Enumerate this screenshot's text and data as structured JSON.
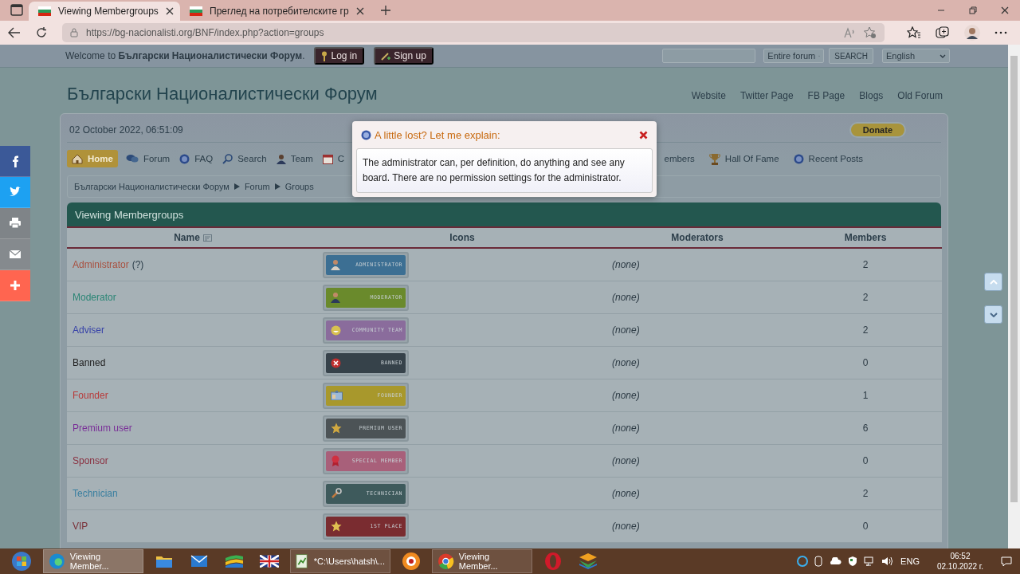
{
  "browser": {
    "tabs": [
      {
        "title": "Viewing Membergroups",
        "selected": true
      },
      {
        "title": "Преглед на потребителските гр",
        "selected": false
      }
    ],
    "url": "https://bg-nacionalisti.org/BNF/index.php?action=groups"
  },
  "userbar": {
    "welcome": "Welcome to **Български Националистически Форум**.",
    "buttons": [
      "Log in",
      "Sign up"
    ],
    "search_scope": "Entire forum",
    "search_button": "SEARCH",
    "language": "English"
  },
  "forum_title": "Български Националистически Форум",
  "top_links": [
    "Website",
    "Twitter Page",
    "FB Page",
    "Blogs",
    "Old Forum"
  ],
  "date": "02 October 2022, 06:51:09",
  "donate": "Donate",
  "nav": [
    {
      "label": "Home",
      "selected": true
    },
    {
      "label": "Forum",
      "selected": false
    },
    {
      "label": "FAQ",
      "selected": false
    },
    {
      "label": "Search",
      "selected": false
    },
    {
      "label": "Team",
      "selected": false
    },
    {
      "label": "C",
      "selected": false
    }
  ],
  "nav_right": [
    {
      "label": "embers",
      "selected": false
    },
    {
      "label": "Hall Of Fame",
      "selected": false
    },
    {
      "label": "Recent Posts",
      "selected": false
    }
  ],
  "breadcrumb": [
    "Български Националистически Форум",
    "Forum",
    "Groups"
  ],
  "table": {
    "title": "Viewing Membergroups",
    "columns": [
      "Name",
      "Icons",
      "Moderators",
      "Members"
    ],
    "rows": [
      {
        "name": "Administrator",
        "help": "(?)",
        "color": "#a8503f",
        "badge": {
          "label": "ADMINISTRATOR",
          "color": "#3c6f93"
        },
        "moderators": "(none)",
        "members": "2"
      },
      {
        "name": "Moderator",
        "color": "#2a8575",
        "badge": {
          "label": "MODERATOR",
          "color": "#6a8a2c"
        },
        "moderators": "(none)",
        "members": "2"
      },
      {
        "name": "Adviser",
        "color": "#3540a8",
        "badge": {
          "label": "COMMUNITY TEAM",
          "color": "#8a6c9c"
        },
        "moderators": "(none)",
        "members": "2"
      },
      {
        "name": "Banned",
        "color": "#222222",
        "badge": {
          "label": "BANNED",
          "color": "#36424a"
        },
        "moderators": "(none)",
        "members": "0"
      },
      {
        "name": "Founder",
        "color": "#b83a3a",
        "badge": {
          "label": "FOUNDER",
          "color": "#a8982c"
        },
        "moderators": "(none)",
        "members": "1"
      },
      {
        "name": "Premium user",
        "color": "#7a3098",
        "badge": {
          "label": "PREMIUM USER",
          "color": "#4c5356"
        },
        "moderators": "(none)",
        "members": "6"
      },
      {
        "name": "Sponsor",
        "color": "#8a3040",
        "badge": {
          "label": "SPECIAL MEMBER",
          "color": "#a8607a"
        },
        "moderators": "(none)",
        "members": "0"
      },
      {
        "name": "Technician",
        "color": "#3a7fa0",
        "badge": {
          "label": "TECHNICIAN",
          "color": "#3e5a5c"
        },
        "moderators": "(none)",
        "members": "2"
      },
      {
        "name": "VIP",
        "color": "#7a3038",
        "badge": {
          "label": "1ST PLACE",
          "color": "#7a2c30"
        },
        "moderators": "(none)",
        "members": "0"
      }
    ]
  },
  "popup": {
    "title": "A little lost? Let me explain:",
    "text": "The administrator can, per definition, do anything and see any board. There are no permission settings for the administrator."
  },
  "taskbar": {
    "apps": [
      {
        "kind": "start"
      },
      {
        "kind": "window",
        "label": "Viewing Member...",
        "selected": true
      },
      {
        "kind": "pinned"
      },
      {
        "kind": "pinned"
      },
      {
        "kind": "pinned"
      },
      {
        "kind": "pinned"
      },
      {
        "kind": "window",
        "label": "*C:\\Users\\hatsh\\...",
        "selected": false
      },
      {
        "kind": "pinned"
      },
      {
        "kind": "window",
        "label": "Viewing Member...",
        "selected": false
      },
      {
        "kind": "pinned"
      },
      {
        "kind": "pinned"
      }
    ],
    "language": "ENG",
    "time": "06:52",
    "date": "02.10.2022 г."
  }
}
